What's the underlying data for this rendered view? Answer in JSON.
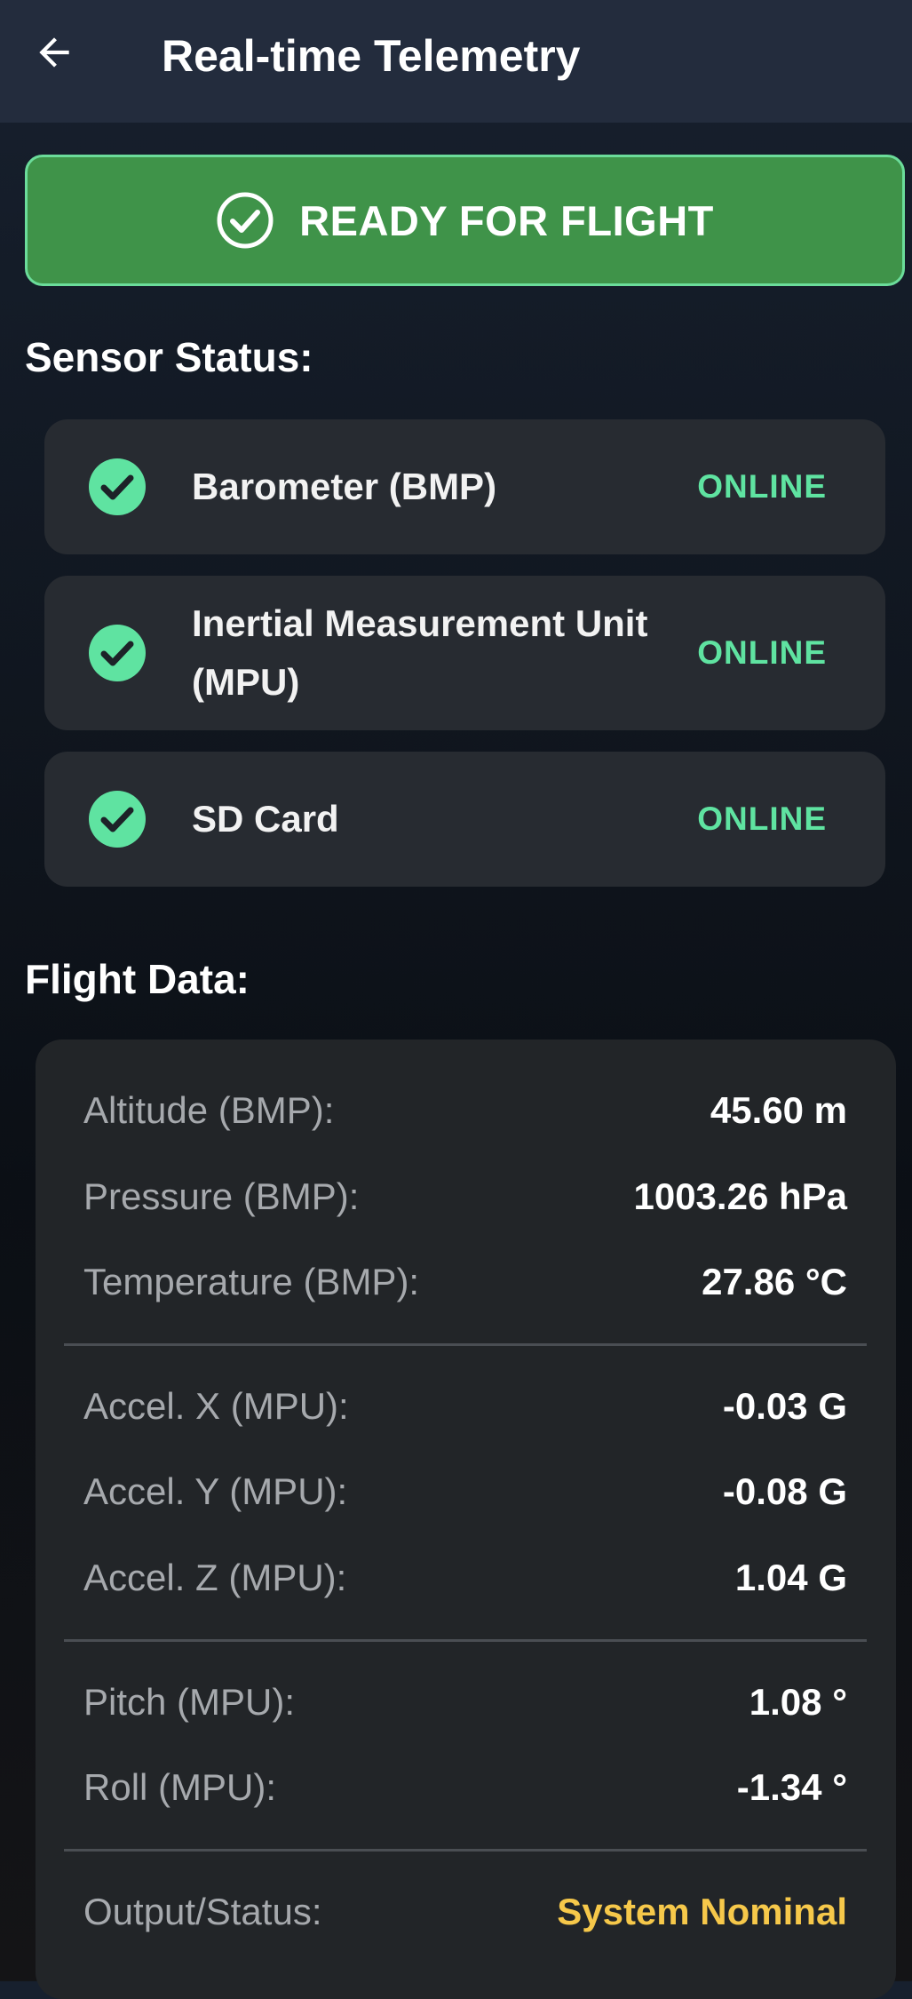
{
  "app_bar": {
    "title": "Real-time Telemetry",
    "back_icon": "arrow-back-icon"
  },
  "ready_banner": {
    "text": "READY FOR FLIGHT",
    "icon": "check-circle-icon",
    "background_color": "#3f9349",
    "border_color": "#6bdc9a"
  },
  "sensor_section": {
    "heading": "Sensor Status:",
    "sensors": [
      {
        "label": "Barometer (BMP)",
        "status": "ONLINE",
        "icon": "check-circle-icon"
      },
      {
        "label": "Inertial Measurement Unit (MPU)",
        "status": "ONLINE",
        "icon": "check-circle-icon"
      },
      {
        "label": "SD Card",
        "status": "ONLINE",
        "icon": "check-circle-icon"
      }
    ],
    "status_color": "#5fe3a1"
  },
  "flight_section": {
    "heading": "Flight Data:",
    "rows": [
      {
        "label": "Altitude (BMP):",
        "value": "45.60 m"
      },
      {
        "label": "Pressure (BMP):",
        "value": "1003.26 hPa"
      },
      {
        "label": "Temperature (BMP):",
        "value": "27.86 °C"
      },
      {
        "label": "Accel. X (MPU):",
        "value": "-0.03 G"
      },
      {
        "label": "Accel. Y (MPU):",
        "value": "-0.08 G"
      },
      {
        "label": "Accel. Z (MPU):",
        "value": "1.04 G"
      },
      {
        "label": "Pitch (MPU):",
        "value": "1.08 °"
      },
      {
        "label": "Roll (MPU):",
        "value": "-1.34 °"
      },
      {
        "label": "Output/Status:",
        "value": "System Nominal"
      }
    ],
    "status_color": "#f6c84a"
  }
}
